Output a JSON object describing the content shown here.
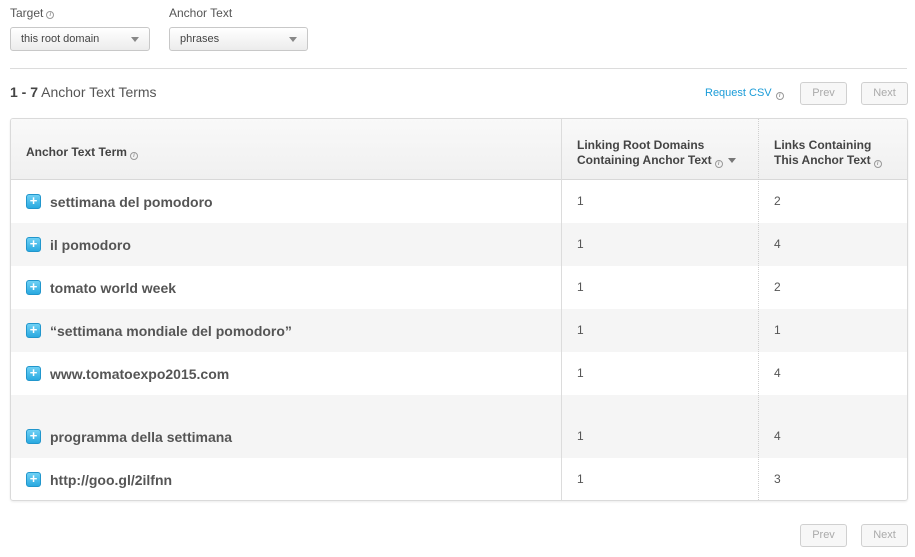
{
  "filters": {
    "target": {
      "label": "Target",
      "value": "this root domain"
    },
    "anchor_text": {
      "label": "Anchor Text",
      "value": "phrases"
    }
  },
  "summary": {
    "range": "1 - 7",
    "label": "Anchor Text Terms"
  },
  "actions": {
    "request_csv": "Request CSV",
    "prev": "Prev",
    "next": "Next"
  },
  "table": {
    "columns": {
      "term": "Anchor Text Term",
      "linking_root_domains_line1": "Linking Root Domains",
      "linking_root_domains_line2": "Containing Anchor Text",
      "links_containing_line1": "Links Containing",
      "links_containing_line2": "This Anchor Text"
    },
    "rows": [
      {
        "term": "settimana del pomodoro",
        "root_domains": "1",
        "links": "2"
      },
      {
        "term": "il pomodoro",
        "root_domains": "1",
        "links": "4"
      },
      {
        "term": "tomato world week",
        "root_domains": "1",
        "links": "2"
      },
      {
        "term": "“settimana mondiale del pomodoro”",
        "root_domains": "1",
        "links": "1"
      },
      {
        "term": "www.tomatoexpo2015.com",
        "root_domains": "1",
        "links": "4"
      },
      {
        "term": "programma della settimana",
        "root_domains": "1",
        "links": "4"
      },
      {
        "term": "http://goo.gl/2ilfnn",
        "root_domains": "1",
        "links": "3"
      }
    ]
  },
  "colors": {
    "accent": "#1b9cd8",
    "expand_button": "#2aa9e0"
  }
}
